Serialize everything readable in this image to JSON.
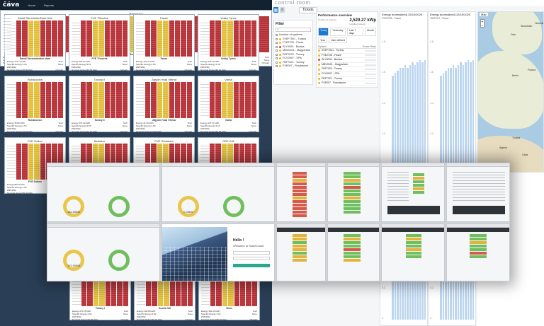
{
  "left_app": {
    "brand": "čáva",
    "nav": [
      "Home",
      "Reports"
    ],
    "cards": [
      {
        "title": "Dandi Sümmösör/Dani-Szin",
        "name": "Dandi Szemmördarn ulam",
        "energy": "Energy:173.70 kWh",
        "specific": "Specific Energy:3.08 kWh/kWp",
        "nominal": "Nominal Output:56.40 kWp",
        "tech": "Tech",
        "tech_val": "None",
        "status": "(Virtual)"
      },
      {
        "title": "FVE Třineček",
        "name": "FVE Třineček",
        "energy": "Energy:225.57 kWh",
        "specific": "Specific Energy:3.51 kWh/kWp",
        "nominal": "Nominal Output:64.35 kWp",
        "tech": "Tech",
        "tech_val": "None",
        "status": "(Virtual)"
      },
      {
        "title": "Fasze",
        "name": "Fasze",
        "energy": "Energy:101.34 kWh",
        "specific": "Specific Energy:1.80 kWh/kWp",
        "nominal": "Nominal Output:56.40 kWp",
        "tech": "Tech",
        "tech_val": "None",
        "status": "(Virtual)"
      },
      {
        "title": "Vekký Týnec",
        "name": "Vekký Týnec",
        "energy": "Energy:134.22 kWh",
        "specific": "Specific Energy:2.38 kWh/kWp",
        "nominal": "Nominal Output:56.40 kWp",
        "tech": "Tech",
        "tech_val": "None",
        "status": "(Virtual)"
      },
      {
        "title": "Roháčovice",
        "name": "Roháčovice",
        "energy": "Energy:35.86 kWh",
        "specific": "Specific Energy:1.54 kWh/kWp",
        "nominal": "Nominal Output:23.25 kWp",
        "tech": "Tech",
        "tech_val": "None",
        "status": "(Virtual)"
      },
      {
        "title": "Turany II",
        "name": "Turany II",
        "energy": "Energy:272.32 kWh",
        "specific": "Specific Energy:2.96 kWh/kWp",
        "nominal": "Nominal Output:92.00 kWp",
        "tech": "Tech",
        "tech_val": "None",
        "status": "(Virtual)"
      },
      {
        "title": "Zdjyčin Hrad Větrná",
        "name": "Zdjyčin Hrad Větrná",
        "energy": "Energy:41.16 kWh",
        "specific": "Specific Energy:1.83 kWh/kWp",
        "nominal": "Nominal Output:22.50 kWp",
        "tech": "Tech",
        "tech_val": "None",
        "status": "(Virtual)"
      },
      {
        "title": "Varha",
        "name": "Varha",
        "energy": "Energy:127.37 kWh",
        "specific": "Specific Energy:2.10 kWh/kWp",
        "nominal": "Nominal Output:60.60 kWp",
        "tech": "Tech",
        "tech_val": "None",
        "status": "(Virtual)"
      },
      {
        "title": "FVE Sulkov",
        "name": "FVE Sulkov",
        "energy": "Energy:88.04 kWh",
        "specific": "Specific Energy:1.56 kWh/kWp",
        "nominal": "Nominal Output:56.40 kWp",
        "tech": "Tech",
        "tech_val": "None",
        "status": "(Virtual)"
      },
      {
        "title": "Nedašov",
        "name": "Nedašov",
        "energy": "",
        "specific": "",
        "nominal": "",
        "tech": "",
        "tech_val": "",
        "status": ""
      },
      {
        "title": "FVE Ořešánka",
        "name": "FVE Ořešánka",
        "energy": "",
        "specific": "",
        "nominal": "",
        "tech": "",
        "tech_val": "",
        "status": ""
      },
      {
        "title": "OBC Zdiř",
        "name": "OBC Zdiř",
        "energy": "",
        "specific": "",
        "nominal": "",
        "tech": "",
        "tech_val": "",
        "status": ""
      }
    ],
    "bottom_left_card": {
      "title": "Bořislavice",
      "name": "Bořislavice",
      "energy": "Energy:170.49 kWh",
      "specific": "Specific Energy:3.02 kWh/kWp",
      "nominal": "Nominal Output:56.40 kWp",
      "tech": "Tech",
      "tech_val": "None",
      "status": "(Virtual)"
    },
    "bottom_cards": [
      {
        "title": "Turany I",
        "name": "Turany I",
        "energy": "Energy:270.15 kWh",
        "specific": "Specific Energy:2.94 kWh/kWp",
        "nominal": "Nominal Output:92.00 kWp",
        "tech": "Tech",
        "tech_val": "None",
        "status": "(Virtual)"
      },
      {
        "title": "Sucha hůl",
        "name": "Sucha hůl",
        "energy": "Energy:102.88 kWh",
        "specific": "Specific Energy:1.82 kWh/kWp",
        "nominal": "Nominal Output:56.40 kWp",
        "tech": "Tech",
        "tech_val": "None",
        "status": "(Virtual)"
      },
      {
        "title": "Slom",
        "name": "Slom",
        "energy": "Energy:181.41 kWh",
        "specific": "Specific Energy:3.22 kWh/kWp",
        "nominal": "Nominal Output:56.40 kWp",
        "tech": "Tech",
        "tech_val": "None",
        "status": "(Virtual)"
      }
    ]
  },
  "right_app": {
    "logo": "control room",
    "tickets_label": "Tickets",
    "filter": {
      "title": "Filter",
      "search_icon": "search-icon",
      "items": [
        {
          "label": "Number of systems",
          "dot": "none"
        },
        {
          "label": "ZVEF7001 - Turany",
          "dot": "yellow"
        },
        {
          "label": "FVE2705 - Fasze",
          "dot": "yellow"
        },
        {
          "label": "SLY0009 - Borska",
          "dot": "red"
        },
        {
          "label": "MBV0021 - Magyarfalu",
          "dot": "yellow"
        },
        {
          "label": "FBF7020 - Turany",
          "dot": "yellow"
        },
        {
          "label": "FCV0007 - SPA",
          "dot": "yellow"
        },
        {
          "label": "FBF7021 - Turany",
          "dot": "yellow"
        },
        {
          "label": "FVE007 - Rosdasone",
          "dot": "yellow"
        }
      ]
    },
    "performance": {
      "title": "Performance overview",
      "kpi_value": "2,529.27 kWp",
      "kpi_label": "Installed capacity",
      "kpi_small_label": "Number of systems",
      "tabs": [
        "Today",
        "Yesterday",
        "Last 7 days",
        "Month"
      ],
      "filter_labels": [
        "Year",
        "User defined"
      ],
      "col_system": "System",
      "col_ratio": "Power Ratio",
      "systems": [
        {
          "label": "ZVEF7001 - Turany",
          "dot": "yellow"
        },
        {
          "label": "FVE2705 - Fasze",
          "dot": "yellow"
        },
        {
          "label": "SLY0009 - Borska",
          "dot": "red"
        },
        {
          "label": "MBV0021 - Magyarfalu",
          "dot": "yellow"
        },
        {
          "label": "FBF7020 - Turany",
          "dot": "yellow"
        },
        {
          "label": "FCV0007 - SPA",
          "dot": "yellow"
        },
        {
          "label": "FBF7021 - Turany",
          "dot": "yellow"
        },
        {
          "label": "FVE007 - Rosdasone",
          "dot": "yellow"
        }
      ]
    },
    "charts": [
      {
        "title": "Energy (normalized)",
        "date": "25/10/2024",
        "subtitle": "FVE2705 - Fasze",
        "yticks": [
          "1.8",
          "1.6",
          "1.4",
          "1.2",
          "1.0",
          "0.8",
          "0.6",
          "0.4",
          "0.2",
          "0"
        ]
      },
      {
        "title": "Energy (normalized)",
        "date": "25/10/2024",
        "subtitle": "TAVF007 - Rosd...",
        "yticks": [
          "1.8",
          "1.6",
          "1.4",
          "1.2",
          "1.0",
          "0.8",
          "0.6",
          "0.4",
          "0.2",
          "0"
        ]
      },
      {
        "title": "Energy (normalized)",
        "date": "25/10/2024",
        "subtitle": "",
        "yticks": [
          "1.8",
          "1.6",
          "1.4",
          "1.2",
          "1.0",
          "0.8",
          "0.6",
          "0.4",
          "0.2",
          "0"
        ]
      }
    ],
    "map": {
      "label": "Map",
      "cities": [
        "Oslo",
        "Stockholm",
        "Helsinki",
        "Berlin",
        "Poland",
        "Algeria",
        "Libya",
        "Tunisia"
      ]
    }
  },
  "overlay": {
    "gauges": [
      {
        "value": "182.00kW",
        "label": "Total Power"
      },
      {
        "value": "0.00kW",
        "label": "Total Power"
      },
      {
        "value": "127.00kW",
        "label": "Total Power"
      }
    ],
    "welcome_title": "Hello !",
    "welcome_subtitle": "Welcome to SolaXCloud"
  }
}
